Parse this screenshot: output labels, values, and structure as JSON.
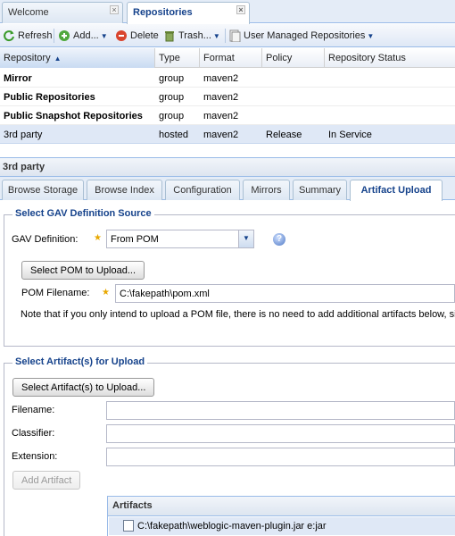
{
  "top_tabs": [
    {
      "label": "Welcome"
    },
    {
      "label": "Repositories"
    }
  ],
  "toolbar": {
    "refresh": "Refresh",
    "add": "Add...",
    "delete": "Delete",
    "trash": "Trash...",
    "user_managed": "User Managed Repositories"
  },
  "grid": {
    "columns": [
      "Repository",
      "Type",
      "Format",
      "Policy",
      "Repository Status"
    ],
    "rows": [
      {
        "name": "Mirror",
        "type": "group",
        "format": "maven2",
        "policy": "",
        "status": ""
      },
      {
        "name": "Public Repositories",
        "type": "group",
        "format": "maven2",
        "policy": "",
        "status": ""
      },
      {
        "name": "Public Snapshot Repositories",
        "type": "group",
        "format": "maven2",
        "policy": "",
        "status": ""
      },
      {
        "name": "3rd party",
        "type": "hosted",
        "format": "maven2",
        "policy": "Release",
        "status": "In Service"
      }
    ]
  },
  "detail": {
    "title": "3rd party",
    "tabs": [
      "Browse Storage",
      "Browse Index",
      "Configuration",
      "Mirrors",
      "Summary",
      "Artifact Upload"
    ]
  },
  "gav_section": {
    "legend": "Select GAV Definition Source",
    "gav_label": "GAV Definition:",
    "gav_value": "From POM",
    "select_pom_button": "Select POM to Upload...",
    "pom_label": "POM Filename:",
    "pom_value": "C:\\fakepath\\pom.xml",
    "note": "Note that if you only intend to upload a POM file, there is no need to add additional artifacts below, si"
  },
  "artifact_section": {
    "legend": "Select Artifact(s) for Upload",
    "select_button": "Select Artifact(s) to Upload...",
    "filename_label": "Filename:",
    "classifier_label": "Classifier:",
    "extension_label": "Extension:",
    "add_button": "Add Artifact",
    "artifacts_header": "Artifacts",
    "artifacts": [
      "C:\\fakepath\\weblogic-maven-plugin.jar e:jar"
    ]
  },
  "colors": {
    "accent": "#15428b",
    "border": "#99bbe8",
    "selected_row": "#dfe8f6",
    "required_star": "#e8a800"
  }
}
